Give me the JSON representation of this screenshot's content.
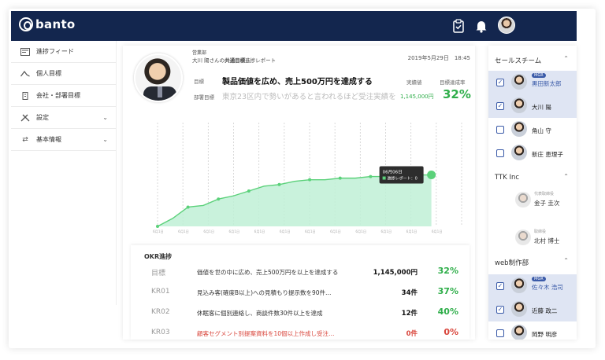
{
  "app": {
    "brand": "banto"
  },
  "header": {
    "icons": [
      "clipboard-check-icon",
      "bell-icon"
    ]
  },
  "sidebar": {
    "items": [
      {
        "label": "進捗フィード",
        "icon": "feed-icon"
      },
      {
        "label": "個人目標",
        "icon": "mountain-icon"
      },
      {
        "label": "会社・部署目標",
        "icon": "building-icon"
      },
      {
        "label": "設定",
        "icon": "tools-icon",
        "expandable": true
      },
      {
        "label": "基本情報",
        "icon": "swap-icon",
        "expandable": true
      }
    ]
  },
  "report": {
    "department": "営業部",
    "subtitle_prefix": "大川 陽さんの",
    "subtitle_bold": "共通目標",
    "subtitle_suffix": "進捗レポート",
    "date": "2019年5月29日　18:45",
    "goal_label": "目標",
    "goal_text": "製品価値を広め、売上500万円を達成する",
    "dept_goal_label": "部署目標",
    "dept_goal_text": "東京23区内で勢いがあると言われるほど受注実績を上げる",
    "actual_label": "実績値",
    "actual_value": "1,145,000円",
    "rate_label": "目標達成率",
    "rate_value": "32%"
  },
  "chart_data": {
    "type": "area",
    "x": [
      "5月1日",
      "5月3日",
      "5月5日",
      "5月7日",
      "5月9日",
      "5月11日",
      "5月13日",
      "5月15日",
      "5月17日",
      "5月19日",
      "5月21日",
      "5月23日",
      "5月25日",
      "5月27日",
      "5月29日",
      "5月31日",
      "6月02日",
      "6月04日",
      "6月06日"
    ],
    "x_ticks": [
      "6月1日",
      "6月1日",
      "6月1日",
      "6月1日",
      "6月1日",
      "6月1日",
      "6月1日",
      "6月1日",
      "6月1日",
      "6月1日",
      "6月1日",
      "6月1日"
    ],
    "values": [
      0,
      5,
      12,
      13,
      17,
      19,
      22,
      25,
      26,
      28,
      29,
      29,
      30,
      30,
      31,
      31,
      32,
      32,
      32
    ],
    "ylim": [
      0,
      100
    ],
    "color": "#5bd17a",
    "tooltip": {
      "date": "06月06日",
      "label": "進捗レポート：0"
    }
  },
  "okr": {
    "title": "OKR進捗",
    "rows": [
      {
        "key": "目標",
        "text": "価値を世の中に広め、売上500万円を以上を達成する",
        "value": "1,145,000円",
        "pct": "32%"
      },
      {
        "key": "KR01",
        "text": "見込み客(確度B以上)への見積もり提示数を90件…",
        "value": "34件",
        "pct": "37%"
      },
      {
        "key": "KR02",
        "text": "休眠客に個別連絡し、商談件数30件以上を達成",
        "value": "12件",
        "pct": "40%"
      },
      {
        "key": "KR03",
        "text": "顧客セグメント別提案資料を10個以上作成し受注…",
        "value": "0件",
        "pct": "0%",
        "alert": true
      }
    ]
  },
  "teams": {
    "sales": {
      "title": "セールスチーム",
      "members": [
        {
          "name": "黒田新太郎",
          "badge": "MGR",
          "checked": true
        },
        {
          "name": "大川 陽",
          "checked": true
        },
        {
          "name": "角山 守",
          "checked": false
        },
        {
          "name": "新庄 恵理子",
          "checked": false
        }
      ]
    },
    "ttk": {
      "title": "TTK Inc",
      "members": [
        {
          "role": "代表取締役",
          "name": "金子 圭次"
        },
        {
          "role": "取締役",
          "name": "北村 博士"
        }
      ]
    },
    "web": {
      "title": "web制作部",
      "members": [
        {
          "name": "佐々木 浩司",
          "badge": "MGR",
          "checked": true
        },
        {
          "name": "近藤 政二",
          "checked": true
        },
        {
          "name": "岡野 明彦",
          "checked": false
        }
      ]
    }
  }
}
